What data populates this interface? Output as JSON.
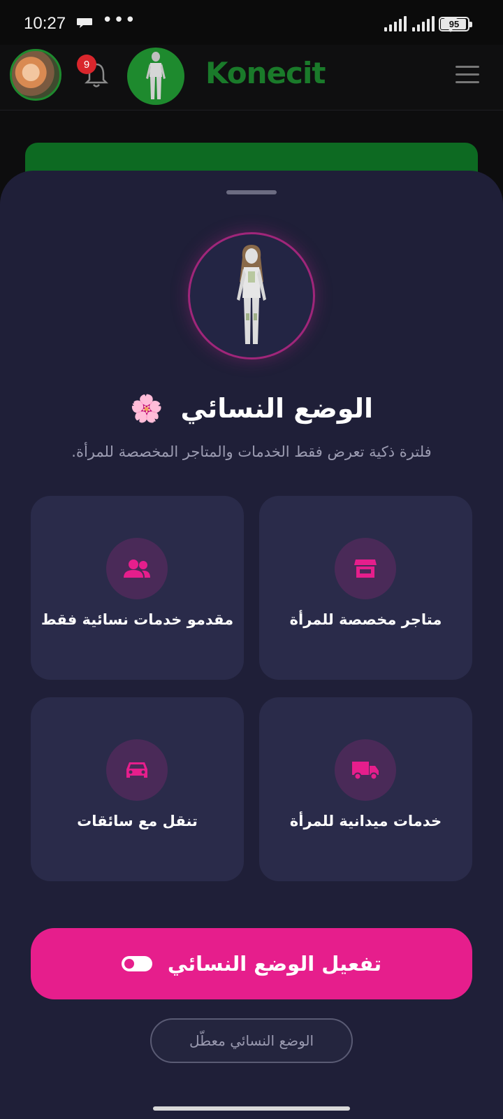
{
  "status_bar": {
    "time": "10:27",
    "dots": "•••",
    "battery_percent": 95,
    "battery_label": "95"
  },
  "header": {
    "notification_count": "9",
    "brand": "Konecit",
    "brand_color": "#1a7a2a"
  },
  "sheet": {
    "title": "الوضع النسائي",
    "title_emoji": "🌸",
    "subtitle": "فلترة ذكية تعرض فقط الخدمات والمتاجر المخصصة للمرأة.",
    "features": [
      {
        "label": "متاجر مخصصة للمرأة",
        "icon": "store-icon"
      },
      {
        "label": "مقدمو خدمات نسائية فقط",
        "icon": "users-icon"
      },
      {
        "label": "خدمات ميدانية للمرأة",
        "icon": "truck-icon"
      },
      {
        "label": "تنقل مع سائقات",
        "icon": "car-icon"
      }
    ],
    "activate_button": "تفعيل الوضع النسائي",
    "status_label": "الوضع النسائي معطّل"
  },
  "colors": {
    "accent": "#e61e8c",
    "sheet_bg": "#1f1f38",
    "card_bg": "#2a2b4a",
    "header_green": "#1e8a2e"
  }
}
